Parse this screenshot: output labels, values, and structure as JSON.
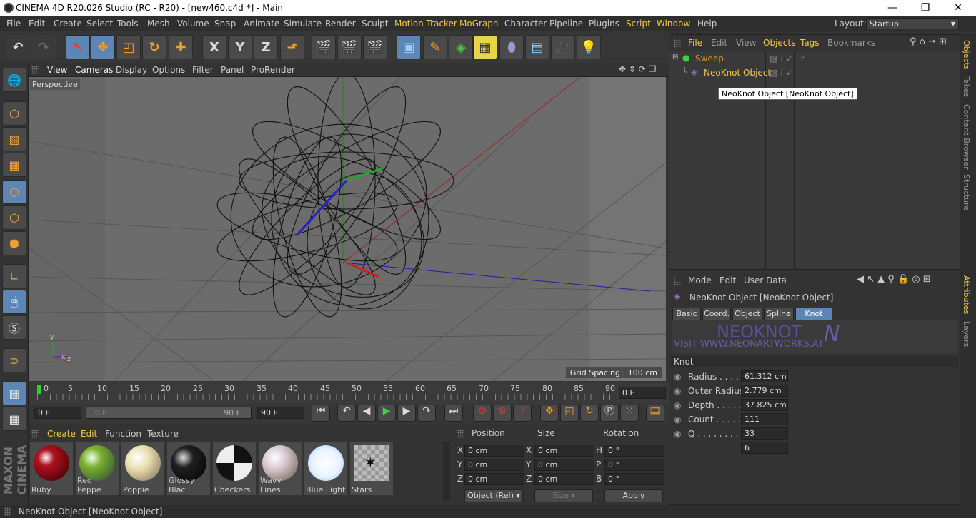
{
  "window": {
    "title": "CINEMA 4D R20.026 Studio (RC - R20) - [new460.c4d *] - Main",
    "minimize": "—",
    "maximize": "❐",
    "close": "✕"
  },
  "menu": [
    "File",
    "Edit",
    "Create",
    "Select",
    "Tools",
    "Mesh",
    "Volume",
    "Snap",
    "Animate",
    "Simulate",
    "Render",
    "Sculpt",
    "Motion Tracker",
    "MoGraph",
    "Character",
    "Pipeline",
    "Plugins",
    "Script",
    "Window",
    "Help"
  ],
  "layout": {
    "label": "Layout:",
    "value": "Startup"
  },
  "toolbar_axes": [
    "X",
    "Y",
    "Z"
  ],
  "viewport": {
    "menu": [
      "View",
      "Cameras",
      "Display",
      "Options",
      "Filter",
      "Panel",
      "ProRender"
    ],
    "camera_label": "Perspective",
    "grid_spacing": "Grid Spacing : 100 cm",
    "axis_x": "x",
    "axis_y": "y",
    "axis_z": "z"
  },
  "timeline": {
    "ticks": [
      "0",
      "5",
      "10",
      "15",
      "20",
      "25",
      "30",
      "35",
      "40",
      "45",
      "50",
      "55",
      "60",
      "65",
      "70",
      "75",
      "80",
      "85",
      "90"
    ],
    "current_frame": "0 F",
    "start": "0 F",
    "range_start": "0 F",
    "range_end": "90 F",
    "end": "90 F"
  },
  "materials": {
    "menu": [
      "Create",
      "Edit",
      "Function",
      "Texture"
    ],
    "items": [
      {
        "name": "Ruby",
        "color": "#b01020"
      },
      {
        "name": "Red Peppe",
        "color": "#7cb030"
      },
      {
        "name": "Poppie",
        "color": "#ece0b0"
      },
      {
        "name": "Glossy Blac",
        "color": "#202020"
      },
      {
        "name": "Checkers",
        "color": "#888888"
      },
      {
        "name": "Wavy Lines",
        "color": "#d8c8d0"
      },
      {
        "name": "Blue Light",
        "color": "#e8f4ff"
      },
      {
        "name": "Stars",
        "color": "#cccccc"
      }
    ]
  },
  "coords": {
    "headers": [
      "Position",
      "Size",
      "Rotation"
    ],
    "rows": [
      {
        "a": "X",
        "pos": "0 cm",
        "b": "X",
        "size": "0 cm",
        "c": "H",
        "rot": "0 °"
      },
      {
        "a": "Y",
        "pos": "0 cm",
        "b": "Y",
        "size": "0 cm",
        "c": "P",
        "rot": "0 °"
      },
      {
        "a": "Z",
        "pos": "0 cm",
        "b": "Z",
        "size": "0 cm",
        "c": "B",
        "rot": "0 °"
      }
    ],
    "mode": "Object (Rel)",
    "size_mode": "Size",
    "apply": "Apply"
  },
  "objects": {
    "menu": [
      "File",
      "Edit",
      "View",
      "Objects",
      "Tags",
      "Bookmarks"
    ],
    "items": [
      {
        "name": "Sweep",
        "color": "#d8902a"
      },
      {
        "name": "NeoKnot Object",
        "color": "#f0c84a"
      }
    ],
    "tooltip": "NeoKnot Object [NeoKnot Object]"
  },
  "attributes": {
    "menu": [
      "Mode",
      "Edit",
      "User Data"
    ],
    "object_title": "NeoKnot Object [NeoKnot Object]",
    "tabs": [
      "Basic",
      "Coord.",
      "Object",
      "Spline",
      "Knot"
    ],
    "active_tab": "Knot",
    "banner_title": "NEOKNOT",
    "banner_url": "VISIT WWW.NEONARTWORKS.AT",
    "section": "Knot",
    "params": [
      {
        "label": "Radius . . . . . .",
        "value": "61.312 cm"
      },
      {
        "label": "Outer Radius",
        "value": "2.779 cm"
      },
      {
        "label": "Depth . . . . . .",
        "value": "37.825 cm"
      },
      {
        "label": "Count . . . . . .",
        "value": "111"
      },
      {
        "label": "Q . . . . . . . . . .",
        "value": "33"
      },
      {
        "label": "",
        "value": "6"
      }
    ]
  },
  "right_tabs": [
    "Objects",
    "Takes",
    "Content Browser",
    "Structure",
    "Attributes",
    "Layers"
  ],
  "brand": "MAXON CINEMA 4D",
  "status": "NeoKnot Object [NeoKnot Object]"
}
